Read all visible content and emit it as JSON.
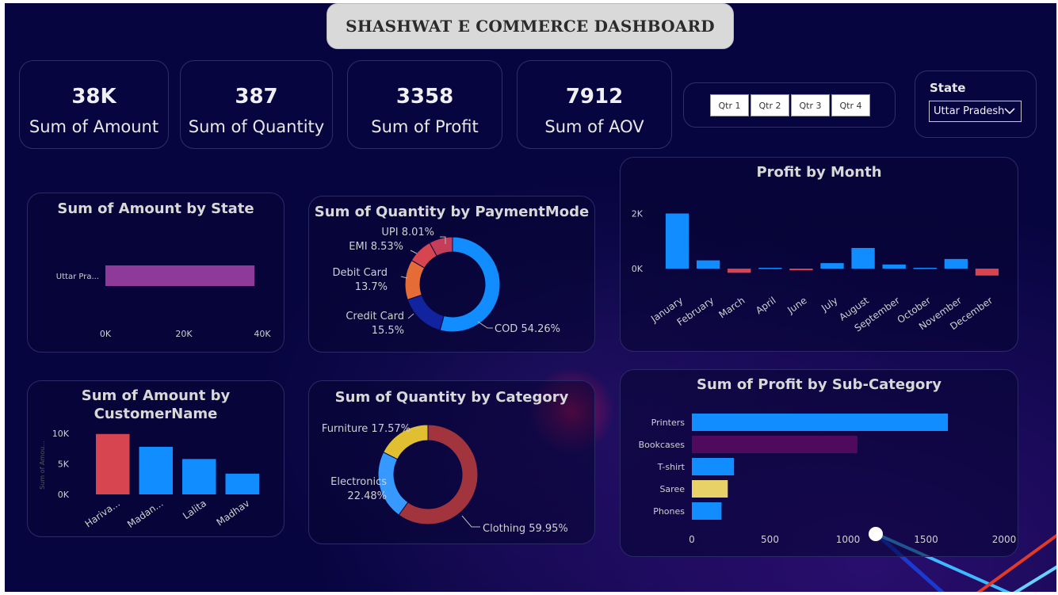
{
  "header": {
    "title": "SHASHWAT E COMMERCE DASHBOARD"
  },
  "kpis": [
    {
      "value": "38K",
      "label": "Sum of Amount"
    },
    {
      "value": "387",
      "label": "Sum of Quantity"
    },
    {
      "value": "3358",
      "label": "Sum of Profit"
    },
    {
      "value": "7912",
      "label": "Sum of AOV"
    }
  ],
  "quarter_slicer": {
    "options": [
      "Qtr 1",
      "Qtr 2",
      "Qtr 3",
      "Qtr 4"
    ]
  },
  "state_filter": {
    "label": "State",
    "selected": "Uttar Pradesh"
  },
  "colors": {
    "background": "#070540",
    "blue": "#118dff",
    "red": "#d64550",
    "purple": "#8d3a9a",
    "darkpurple": "#4f0a5e",
    "orange": "#e66c37",
    "navy": "#12239e",
    "yellow": "#e8d166",
    "goldenrod": "#e0c030",
    "maroon": "#a1343c",
    "lightblue": "#3599ff"
  },
  "charts": {
    "amount_by_state": {
      "title": "Sum of Amount by State"
    },
    "qty_by_payment": {
      "title": "Sum of Quantity by PaymentMode"
    },
    "profit_by_month": {
      "title": "Profit by Month"
    },
    "amount_by_customer": {
      "title": "Sum of Amount by CustomerName"
    },
    "qty_by_category": {
      "title": "Sum of Quantity by Category"
    },
    "profit_by_subcat": {
      "title": "Sum of Profit by Sub-Category"
    }
  },
  "chart_data": [
    {
      "id": "amount_by_state",
      "type": "bar",
      "orientation": "horizontal",
      "title": "Sum of Amount by State",
      "categories": [
        "Uttar Pra..."
      ],
      "values": [
        38000
      ],
      "xlim": [
        0,
        40000
      ],
      "ticks": [
        "0K",
        "20K",
        "40K"
      ],
      "color": "#8d3a9a"
    },
    {
      "id": "qty_by_payment",
      "type": "pie",
      "donut": true,
      "title": "Sum of Quantity by PaymentMode",
      "slices": [
        {
          "label": "COD",
          "value": 54.26,
          "display": "COD 54.26%",
          "color": "#118dff"
        },
        {
          "label": "Credit Card",
          "value": 15.5,
          "display": "Credit Card\n15.5%",
          "color": "#12239e"
        },
        {
          "label": "Debit Card",
          "value": 13.7,
          "display": "Debit Card\n13.7%",
          "color": "#e66c37"
        },
        {
          "label": "EMI",
          "value": 8.53,
          "display": "EMI 8.53%",
          "color": "#d64550"
        },
        {
          "label": "UPI",
          "value": 8.01,
          "display": "UPI 8.01%",
          "color": "#c43e5a"
        }
      ]
    },
    {
      "id": "profit_by_month",
      "type": "bar",
      "title": "Profit by Month",
      "categories": [
        "January",
        "February",
        "March",
        "April",
        "June",
        "July",
        "August",
        "September",
        "October",
        "November",
        "December"
      ],
      "values": [
        2000,
        300,
        -150,
        30,
        -60,
        200,
        750,
        150,
        30,
        350,
        -250
      ],
      "ylim": [
        -400,
        2300
      ],
      "ticks": [
        "2K",
        "0K"
      ],
      "pos_color": "#118dff",
      "neg_color": "#d64550"
    },
    {
      "id": "amount_by_customer",
      "type": "bar",
      "title": "Sum of Amount by CustomerName",
      "categories": [
        "Hariva...",
        "Madan...",
        "Lalita",
        "Madhav"
      ],
      "values": [
        9900,
        7800,
        5800,
        3400
      ],
      "ylim": [
        0,
        10000
      ],
      "ticks": [
        "10K",
        "5K",
        "0K"
      ],
      "ylabel": "Sum of Amou...",
      "colors": [
        "#d64550",
        "#118dff",
        "#118dff",
        "#118dff"
      ]
    },
    {
      "id": "qty_by_category",
      "type": "pie",
      "donut": true,
      "title": "Sum of Quantity by Category",
      "slices": [
        {
          "label": "Clothing",
          "value": 59.95,
          "display": "Clothing 59.95%",
          "color": "#a1343c"
        },
        {
          "label": "Electronics",
          "value": 22.48,
          "display": "Electronics\n22.48%",
          "color": "#3599ff"
        },
        {
          "label": "Furniture",
          "value": 17.57,
          "display": "Furniture 17.57%",
          "color": "#e0c030"
        }
      ]
    },
    {
      "id": "profit_by_subcat",
      "type": "bar",
      "orientation": "horizontal",
      "title": "Sum of Profit by Sub-Category",
      "categories": [
        "Printers",
        "Bookcases",
        "T-shirt",
        "Saree",
        "Phones"
      ],
      "values": [
        1640,
        1060,
        270,
        230,
        190
      ],
      "xlim": [
        0,
        2000
      ],
      "ticks": [
        "0",
        "500",
        "1000",
        "1500",
        "2000"
      ],
      "colors": [
        "#118dff",
        "#4f0a5e",
        "#118dff",
        "#e8d166",
        "#118dff"
      ]
    }
  ]
}
